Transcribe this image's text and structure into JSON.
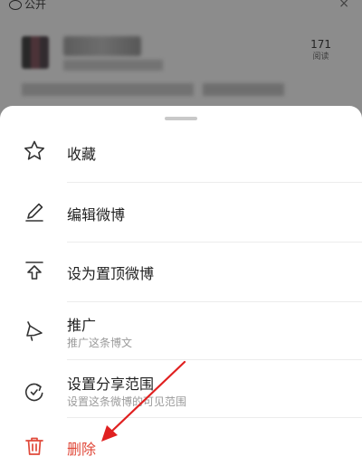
{
  "background": {
    "visibility_label": "公开",
    "stat_count": "171",
    "stat_label": "阅读"
  },
  "menu": {
    "items": [
      {
        "id": "favorite",
        "label": "收藏",
        "icon": "star-icon"
      },
      {
        "id": "edit",
        "label": "编辑微博",
        "icon": "pencil-icon"
      },
      {
        "id": "pin",
        "label": "设为置顶微博",
        "icon": "pin-top-icon"
      },
      {
        "id": "promote",
        "label": "推广",
        "sub": "推广这条博文",
        "icon": "megaphone-icon"
      },
      {
        "id": "share-range",
        "label": "设置分享范围",
        "sub": "设置这条微博的可见范围",
        "icon": "share-range-icon"
      },
      {
        "id": "delete",
        "label": "删除",
        "icon": "trash-icon"
      }
    ]
  },
  "colors": {
    "danger": "#e0493a",
    "annotation_arrow": "#e02020",
    "overlay": "rgba(0,0,0,0.45)"
  }
}
